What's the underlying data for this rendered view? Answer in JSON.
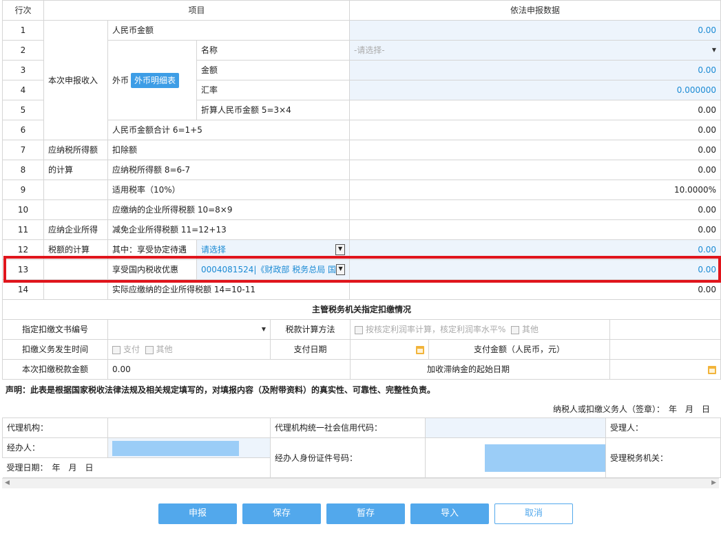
{
  "header": {
    "col_row": "行次",
    "col_item": "项目",
    "col_data": "依法申报数据"
  },
  "groups": {
    "income": "本次申报收入",
    "taxable_1": "应纳税所得额",
    "taxable_2": "的计算",
    "corp_tax_1": "应纳企业所得",
    "corp_tax_2": "税额的计算"
  },
  "foreign": {
    "label": "外币",
    "detail_button": "外币明细表"
  },
  "rows": [
    {
      "no": "1",
      "label": "人民币金额",
      "value": "0.00"
    },
    {
      "no": "2",
      "label": "名称",
      "value": "-请选择-"
    },
    {
      "no": "3",
      "label": "金额",
      "value": "0.00"
    },
    {
      "no": "4",
      "label": "汇率",
      "value": "0.000000"
    },
    {
      "no": "5",
      "label": "折算人民币金额 5=3×4",
      "value": "0.00"
    },
    {
      "no": "6",
      "label": "人民币金额合计 6=1+5",
      "value": "0.00"
    },
    {
      "no": "7",
      "label": "扣除额",
      "value": "0.00"
    },
    {
      "no": "8",
      "label": "应纳税所得额 8=6-7",
      "value": "0.00"
    },
    {
      "no": "9",
      "label": "适用税率（10%）",
      "value": "10.0000%"
    },
    {
      "no": "10",
      "label": "应缴纳的企业所得税额 10=8×9",
      "value": "0.00"
    },
    {
      "no": "11",
      "label": "减免企业所得税额 11=12+13",
      "value": "0.00"
    },
    {
      "no": "12",
      "label": "其中：享受协定待遇",
      "select": "请选择",
      "value": "0.00"
    },
    {
      "no": "13",
      "label": "享受国内税收优惠",
      "select": "0004081524|《财政部 税务总局 国",
      "value": "0.00"
    },
    {
      "no": "14",
      "label": "实际应缴纳的企业所得税额 14=10-11",
      "value": "0.00"
    }
  ],
  "withholding": {
    "title": "主管税务机关指定扣缴情况",
    "doc_no_label": "指定扣缴文书编号",
    "calc_method_label": "税款计算方法",
    "calc_opt1": "按核定利润率计算，核定利润率水平%",
    "calc_opt2": "其他",
    "time_label": "扣缴义务发生时间",
    "time_opt1": "支付",
    "time_opt2": "其他",
    "pay_date_label": "支付日期",
    "pay_amount_label": "支付金额（人民币，元）",
    "amount_label": "本次扣缴税款金额",
    "amount_value": "0.00",
    "late_fee_label": "加收滞纳金的起始日期"
  },
  "declaration": "声明：此表是根据国家税收法律法规及相关规定填写的，对填报内容（及附带资料）的真实性、可靠性、完整性负责。",
  "signature": "纳税人或扣缴义务人（签章）：　年　月　日",
  "agent": {
    "agency": "代理机构：",
    "agency_code": "代理机构统一社会信用代码：",
    "receiver": "受理人：",
    "handler": "经办人：",
    "handler_id": "经办人身份证件号码：",
    "receiving_office": "受理税务机关：",
    "receive_date": "受理日期：　年　月　日"
  },
  "buttons": {
    "submit": "申报",
    "save": "保存",
    "temp": "暂存",
    "import": "导入",
    "cancel": "取消"
  },
  "colors": {
    "accent": "#52a8ec",
    "highlight": "#e0151c",
    "input_bg": "#edf4fc"
  }
}
